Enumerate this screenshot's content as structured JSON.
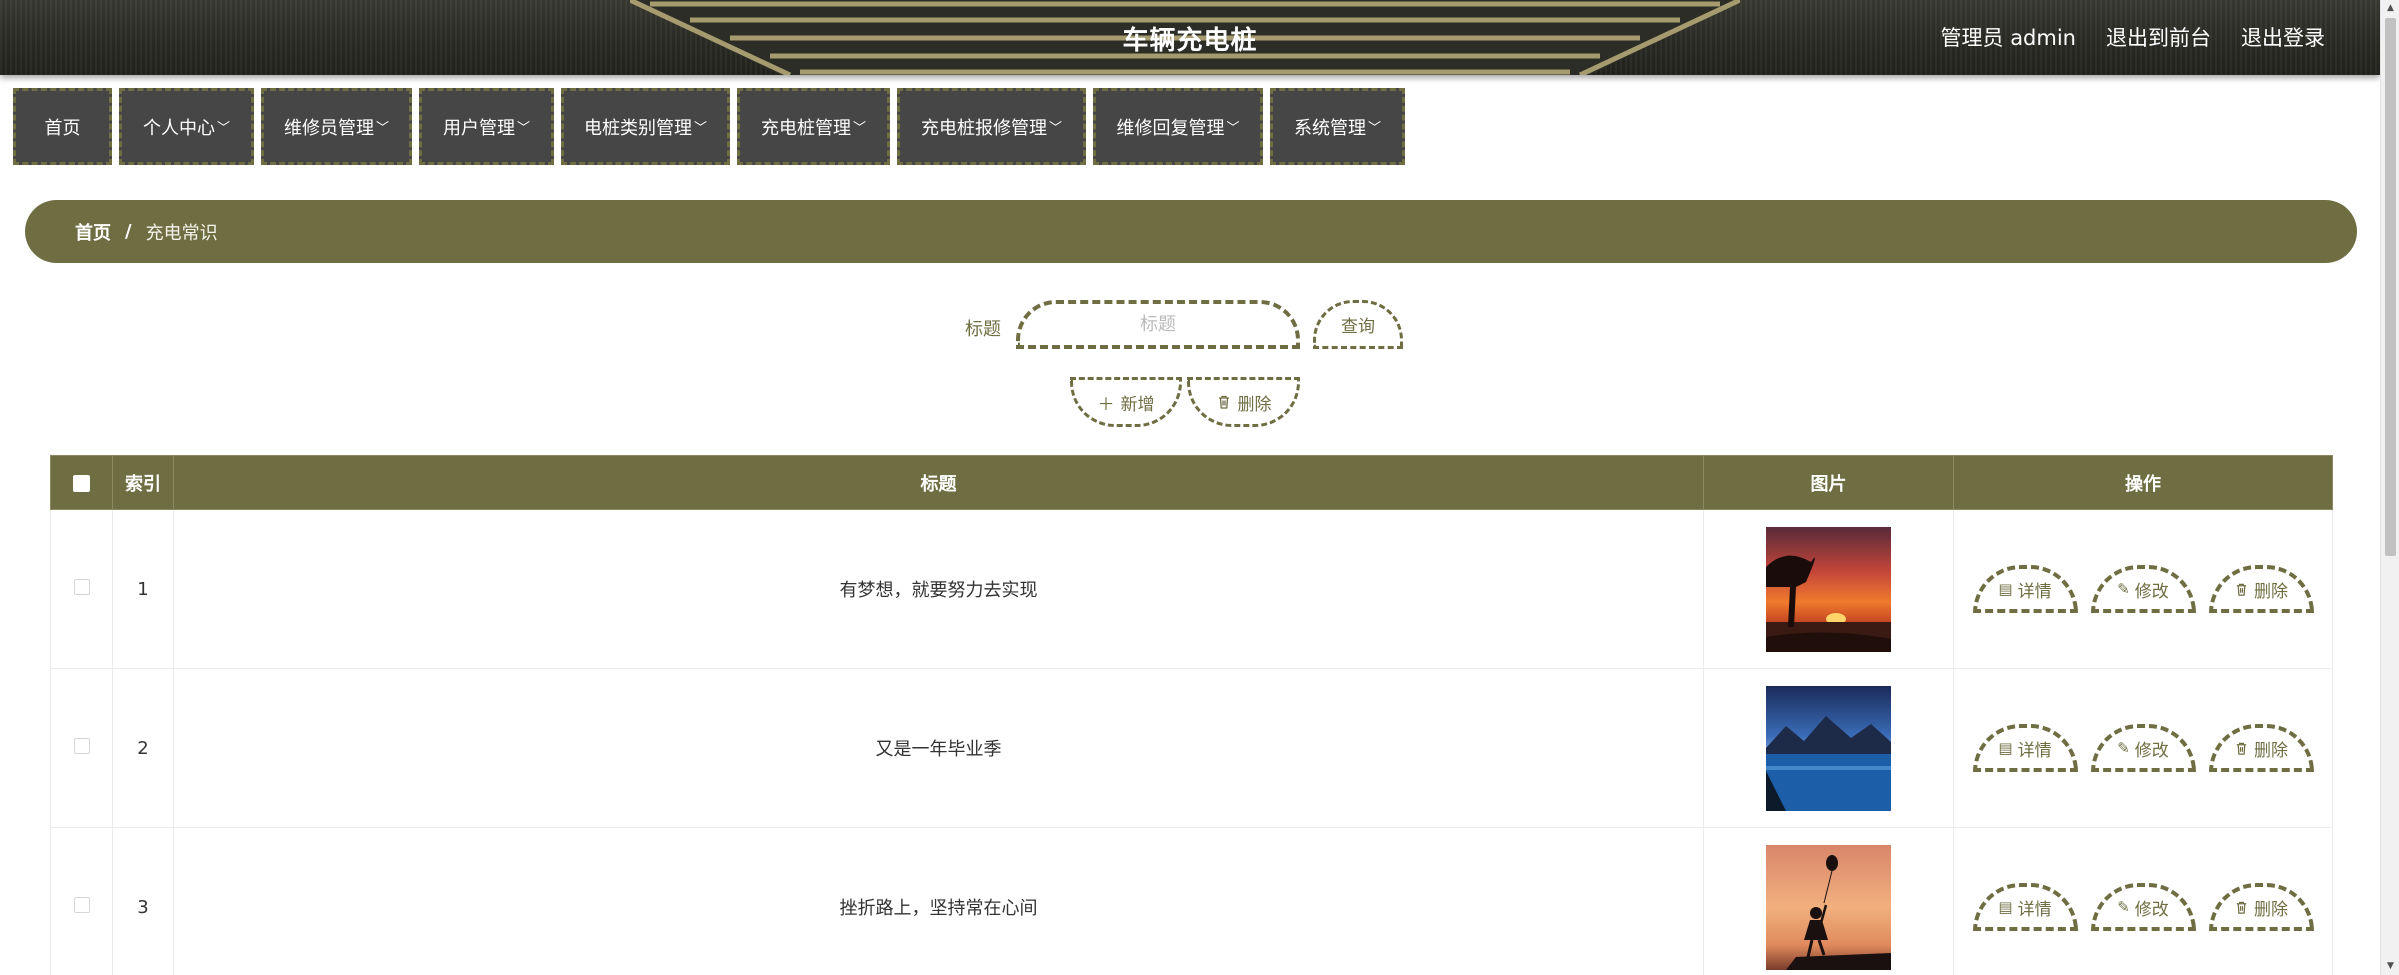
{
  "header": {
    "title": "车辆充电桩",
    "admin_label": "管理员 admin",
    "front_link": "退出到前台",
    "logout_link": "退出登录"
  },
  "nav": {
    "items": [
      {
        "label": "首页",
        "dropdown": false
      },
      {
        "label": "个人中心",
        "dropdown": true
      },
      {
        "label": "维修员管理",
        "dropdown": true
      },
      {
        "label": "用户管理",
        "dropdown": true
      },
      {
        "label": "电桩类别管理",
        "dropdown": true
      },
      {
        "label": "充电桩管理",
        "dropdown": true
      },
      {
        "label": "充电桩报修管理",
        "dropdown": true
      },
      {
        "label": "维修回复管理",
        "dropdown": true
      },
      {
        "label": "系统管理",
        "dropdown": true
      }
    ]
  },
  "breadcrumb": {
    "home": "首页",
    "separator": "/",
    "current": "充电常识"
  },
  "search": {
    "label": "标题",
    "placeholder": "标题",
    "query_button": "查询"
  },
  "actions": {
    "add": "新增",
    "delete": "删除"
  },
  "table": {
    "columns": [
      "索引",
      "标题",
      "图片",
      "操作"
    ],
    "rows": [
      {
        "index": "1",
        "title": "有梦想，就要努力去实现",
        "image": "sunset-tree"
      },
      {
        "index": "2",
        "title": "又是一年毕业季",
        "image": "lake-mountains"
      },
      {
        "index": "3",
        "title": "挫折路上，坚持常在心间",
        "image": "girl-balloon"
      }
    ],
    "row_actions": {
      "detail": "详情",
      "edit": "修改",
      "delete": "删除"
    }
  },
  "colors": {
    "accent": "#6f6e43",
    "nav_bg": "#464646",
    "header_bg": "#2e2f29"
  }
}
